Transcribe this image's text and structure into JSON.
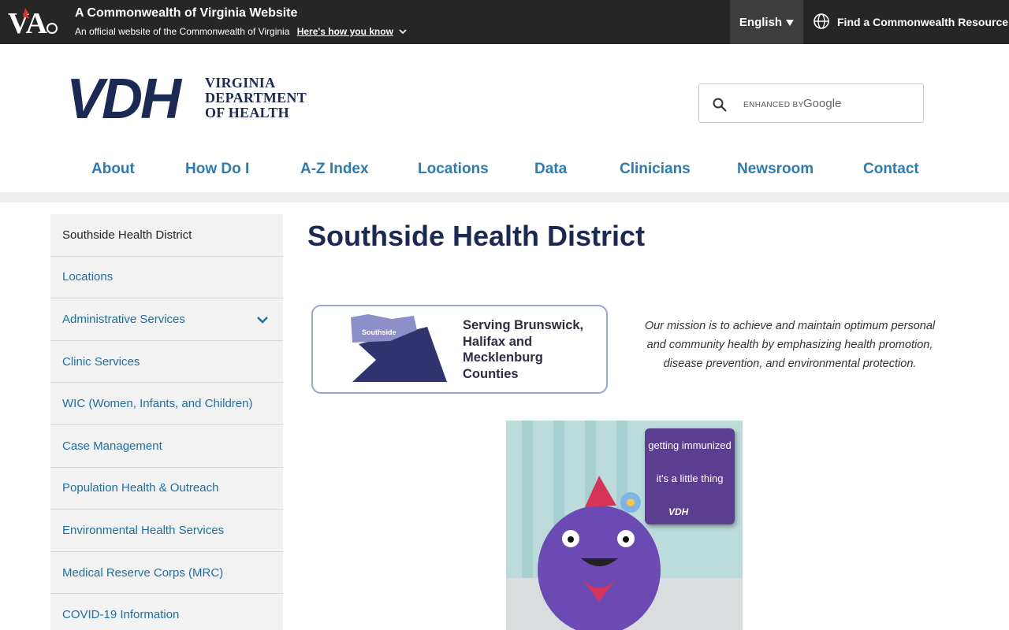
{
  "commonwealth_bar": {
    "title": "A Commonwealth of Virginia Website",
    "subtitle": "An official website of the Commonwealth of Virginia",
    "how_link": "Here's how you know",
    "language": "English",
    "resource": "Find a Commonwealth Resource"
  },
  "header": {
    "logo_letters": "VDH",
    "logo_line1": "VIRGINIA",
    "logo_line2": "DEPARTMENT",
    "logo_line3": "OF HEALTH",
    "search_enhanced": "ENHANCED BY",
    "search_brand": "Google"
  },
  "nav": {
    "items": [
      "About",
      "How Do I",
      "A-Z Index",
      "Locations",
      "Data",
      "Clinicians",
      "Newsroom",
      "Contact"
    ]
  },
  "sidebar": {
    "items": [
      "Southside Health District",
      "Locations",
      "Administrative Services",
      "Clinic Services",
      "WIC (Women, Infants, and Children)",
      "Case Management",
      "Population Health & Outreach",
      "Environmental Health Services",
      "Medical Reserve Corps (MRC)",
      "COVID-19 Information"
    ]
  },
  "main": {
    "title": "Southside Health District",
    "serving_line1": "Serving Brunswick,",
    "serving_line2": "Halifax and",
    "serving_line3": "Mecklenburg",
    "serving_line4": "Counties",
    "map_label": "Southside",
    "mission": "Our mission is to achieve and maintain optimum personal and community health by emphasizing health promotion, disease prevention, and environmental protection.",
    "promo_line1": "getting immunized",
    "promo_line2": "it's a little thing",
    "promo_logo": "VDH"
  },
  "colors": {
    "navy": "#1b2a55",
    "link_blue": "#2e7bb4",
    "sidebar_link": "#1f6f9f",
    "top_bar": "#262626"
  }
}
